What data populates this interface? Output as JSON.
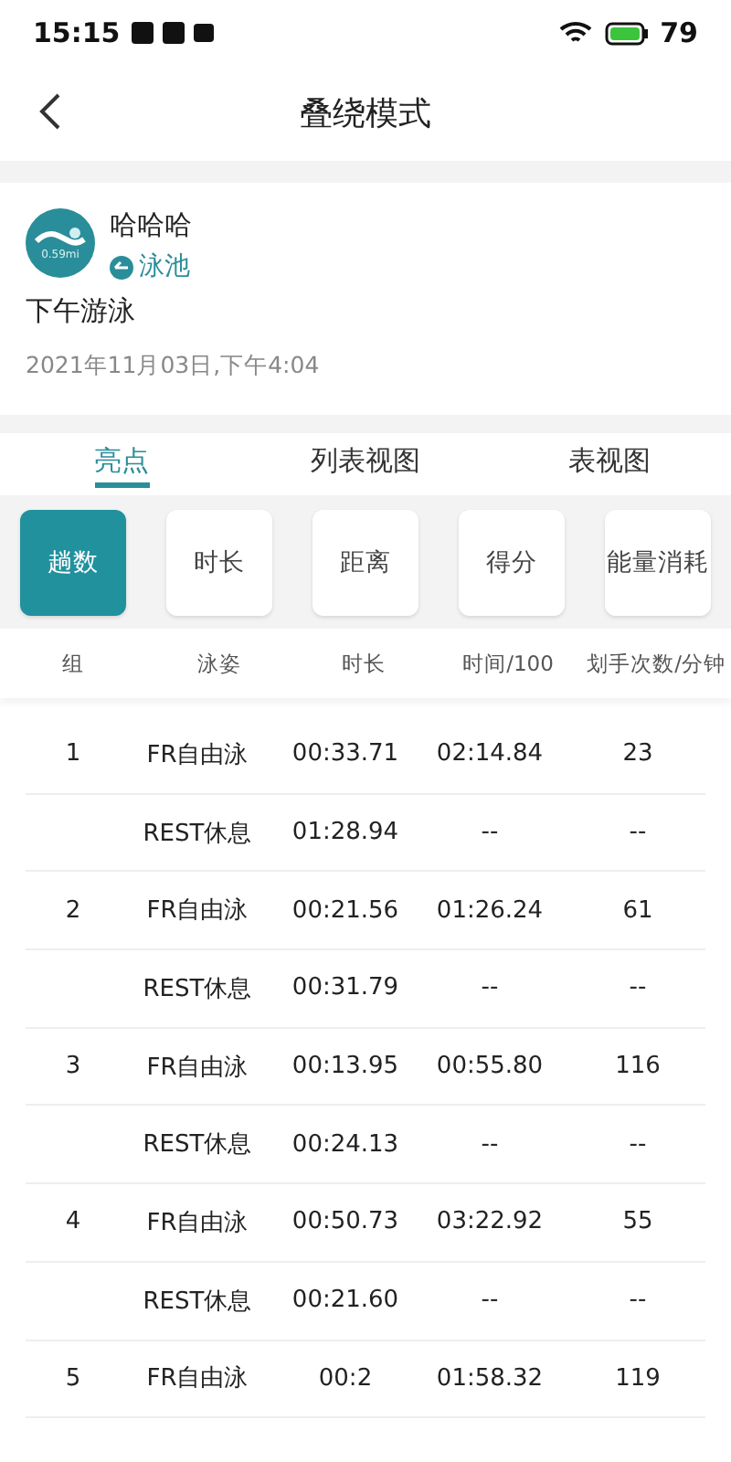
{
  "status_bar": {
    "time": "15:15",
    "battery": "79"
  },
  "header": {
    "title": "叠绕模式"
  },
  "profile": {
    "name": "哈哈哈",
    "badge_text": "0.59mi",
    "location": "泳池",
    "activity": "下午游泳",
    "datetime": "2021年11月03日,下午4:04"
  },
  "tabs": [
    {
      "label": "亮点",
      "selected": true
    },
    {
      "label": "列表视图",
      "selected": false
    },
    {
      "label": "表视图",
      "selected": false
    }
  ],
  "metrics": [
    {
      "label": "趟数",
      "selected": true
    },
    {
      "label": "时长",
      "selected": false
    },
    {
      "label": "距离",
      "selected": false
    },
    {
      "label": "得分",
      "selected": false
    },
    {
      "label": "能量消耗",
      "selected": false
    }
  ],
  "table": {
    "columns": [
      "组",
      "泳姿",
      "时长",
      "时间/100",
      "划手次数/分钟"
    ],
    "rows": [
      [
        "1",
        "FR自由泳",
        "00:33.71",
        "02:14.84",
        "23"
      ],
      [
        "",
        "REST休息",
        "01:28.94",
        "--",
        "--"
      ],
      [
        "2",
        "FR自由泳",
        "00:21.56",
        "01:26.24",
        "61"
      ],
      [
        "",
        "REST休息",
        "00:31.79",
        "--",
        "--"
      ],
      [
        "3",
        "FR自由泳",
        "00:13.95",
        "00:55.80",
        "116"
      ],
      [
        "",
        "REST休息",
        "00:24.13",
        "--",
        "--"
      ],
      [
        "4",
        "FR自由泳",
        "00:50.73",
        "03:22.92",
        "55"
      ],
      [
        "",
        "REST休息",
        "00:21.60",
        "--",
        "--"
      ],
      [
        "5",
        "FR自由泳",
        "00:2",
        "01:58.32",
        "119"
      ]
    ]
  }
}
